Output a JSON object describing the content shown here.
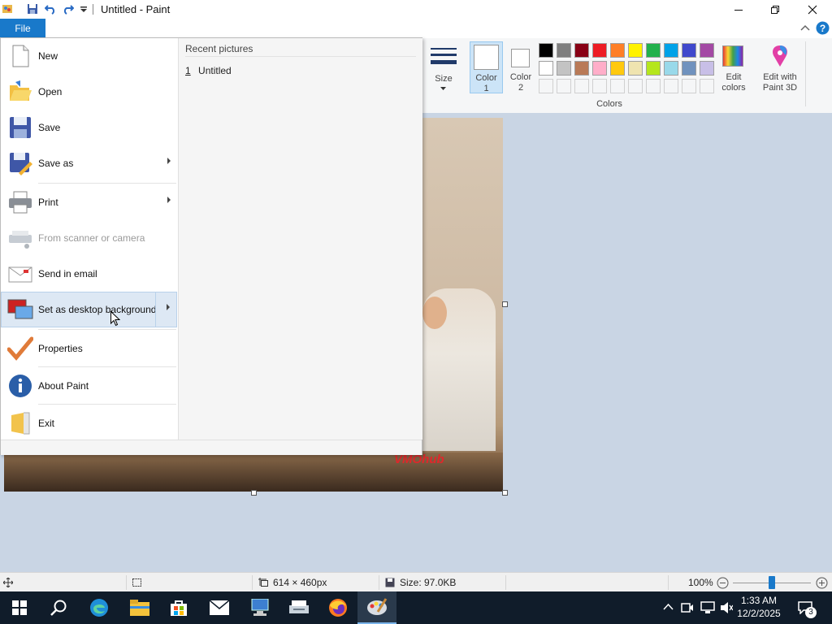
{
  "app": {
    "title": "Untitled - Paint"
  },
  "ribbon": {
    "file_tab": "File",
    "size_label": "Size",
    "color1_label": "Color\n1",
    "color1_l1": "Color",
    "color1_l2": "1",
    "color2_l1": "Color",
    "color2_l2": "2",
    "edit_colors_l1": "Edit",
    "edit_colors_l2": "colors",
    "paint3d_l1": "Edit with",
    "paint3d_l2": "Paint 3D",
    "colors_group_label": "Colors",
    "palette_row1": [
      "#000000",
      "#7f7f7f",
      "#880015",
      "#ed1c24",
      "#ff7f27",
      "#fff200",
      "#22b14c",
      "#00a2e8",
      "#3f48cc",
      "#a349a4"
    ],
    "palette_row2": [
      "#ffffff",
      "#c3c3c3",
      "#b97a57",
      "#ffaec9",
      "#ffc90e",
      "#efe4b0",
      "#b5e61d",
      "#99d9ea",
      "#7092be",
      "#c8bfe7"
    ]
  },
  "file_menu": {
    "items": [
      {
        "label": "New",
        "icon": "new-file-icon"
      },
      {
        "label": "Open",
        "icon": "open-folder-icon"
      },
      {
        "label": "Save",
        "icon": "save-disk-icon"
      },
      {
        "label": "Save as",
        "icon": "save-as-icon"
      },
      {
        "label": "Print",
        "icon": "printer-icon"
      },
      {
        "label": "From scanner or camera",
        "icon": "scanner-icon"
      },
      {
        "label": "Send in email",
        "icon": "email-icon"
      },
      {
        "label": "Set as desktop background",
        "icon": "desktop-background-icon"
      },
      {
        "label": "Properties",
        "icon": "checkmark-icon"
      },
      {
        "label": "About Paint",
        "icon": "info-icon"
      },
      {
        "label": "Exit",
        "icon": "exit-icon"
      }
    ],
    "recent_heading": "Recent pictures",
    "recent_items": [
      {
        "index": "1",
        "name": "Untitled"
      }
    ]
  },
  "canvas": {
    "watermark": "VMOhub"
  },
  "statusbar": {
    "dimensions": "614 × 460px",
    "size": "Size: 97.0KB",
    "zoom": "100%",
    "zoom_slider_value": 0.5
  },
  "taskbar": {
    "time": "1:33 AM",
    "date": "12/2/2025",
    "notification_count": "3"
  }
}
